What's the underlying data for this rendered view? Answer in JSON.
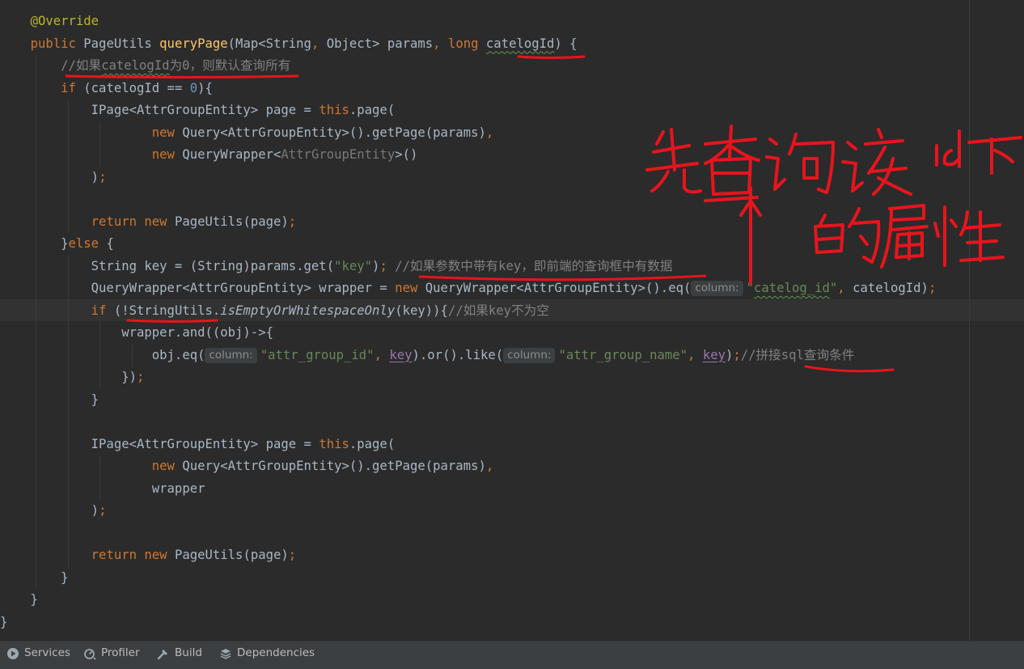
{
  "editor": {
    "lines": [
      {
        "name": "code-line-1",
        "tokens": [
          {
            "t": "    "
          },
          {
            "t": "@Override",
            "c": "ann"
          }
        ]
      },
      {
        "name": "code-line-2",
        "tokens": [
          {
            "t": "    "
          },
          {
            "t": "public ",
            "c": "kw"
          },
          {
            "t": "PageUtils "
          },
          {
            "t": "queryPage",
            "c": "fn"
          },
          {
            "t": "(Map<String"
          },
          {
            "t": ", ",
            "c": "kw"
          },
          {
            "t": "Object> params"
          },
          {
            "t": ", ",
            "c": "kw"
          },
          {
            "t": "long ",
            "c": "kw"
          },
          {
            "t": "catelogId",
            "c": "wavy"
          },
          {
            "t": ") {"
          }
        ]
      },
      {
        "name": "code-line-3",
        "tokens": [
          {
            "t": "        "
          },
          {
            "t": "//如果",
            "c": "com"
          },
          {
            "t": "catelogId",
            "c": "com wavy"
          },
          {
            "t": "为0，则默认查询所有",
            "c": "com"
          }
        ]
      },
      {
        "name": "code-line-4",
        "tokens": [
          {
            "t": "        "
          },
          {
            "t": "if ",
            "c": "kw"
          },
          {
            "t": "(catelogId == "
          },
          {
            "t": "0",
            "c": "num"
          },
          {
            "t": "){"
          }
        ]
      },
      {
        "name": "code-line-5",
        "tokens": [
          {
            "t": "            IPage<AttrGroupEntity> page = "
          },
          {
            "t": "this",
            "c": "kw"
          },
          {
            "t": ".page("
          }
        ]
      },
      {
        "name": "code-line-6",
        "tokens": [
          {
            "t": "                    "
          },
          {
            "t": "new ",
            "c": "kw"
          },
          {
            "t": "Query<AttrGroupEntity>().getPage(params)"
          },
          {
            "t": ",",
            "c": "kw"
          }
        ]
      },
      {
        "name": "code-line-7",
        "tokens": [
          {
            "t": "                    "
          },
          {
            "t": "new ",
            "c": "kw"
          },
          {
            "t": "QueryWrapper<"
          },
          {
            "t": "AttrGroupEntity",
            "c": "dim"
          },
          {
            "t": ">()"
          }
        ]
      },
      {
        "name": "code-line-8",
        "tokens": [
          {
            "t": "            )"
          },
          {
            "t": ";",
            "c": "kw"
          }
        ]
      },
      {
        "name": "code-line-9",
        "tokens": [
          {
            "t": ""
          }
        ]
      },
      {
        "name": "code-line-10",
        "tokens": [
          {
            "t": "            "
          },
          {
            "t": "return new ",
            "c": "kw"
          },
          {
            "t": "PageUtils(page)"
          },
          {
            "t": ";",
            "c": "kw"
          }
        ]
      },
      {
        "name": "code-line-11",
        "tokens": [
          {
            "t": "        }"
          },
          {
            "t": "else ",
            "c": "kw"
          },
          {
            "t": "{"
          }
        ]
      },
      {
        "name": "code-line-12",
        "tokens": [
          {
            "t": "            String key = (String)params.get("
          },
          {
            "t": "\"key\"",
            "c": "str"
          },
          {
            "t": ")"
          },
          {
            "t": "; ",
            "c": "kw"
          },
          {
            "t": "//如果参数中带有key，即前端的查询框中有数据",
            "c": "com"
          }
        ]
      },
      {
        "name": "code-line-13",
        "tokens": [
          {
            "t": "            QueryWrapper<AttrGroupEntity> wrapper = "
          },
          {
            "t": "new ",
            "c": "kw"
          },
          {
            "t": "QueryWrapper<AttrGroupEntity>().eq("
          },
          {
            "t": "column:",
            "c": "hint"
          },
          {
            "t": "\"",
            "c": "str"
          },
          {
            "t": "catelog_id",
            "c": "str wavy"
          },
          {
            "t": "\"",
            "c": "str"
          },
          {
            "t": ", ",
            "c": "kw"
          },
          {
            "t": "catelogId)"
          },
          {
            "t": ";",
            "c": "kw"
          }
        ]
      },
      {
        "name": "code-line-14",
        "tokens": [
          {
            "t": "            "
          },
          {
            "t": "if ",
            "c": "kw"
          },
          {
            "t": "(!StringUtils."
          },
          {
            "t": "isEmptyOrWhitespaceOnly",
            "c": "it"
          },
          {
            "t": "(key)){"
          },
          {
            "t": "//如果key不为空",
            "c": "com"
          }
        ]
      },
      {
        "name": "code-line-15",
        "tokens": [
          {
            "t": "                wrapper.and((obj)->{"
          }
        ]
      },
      {
        "name": "code-line-16",
        "tokens": [
          {
            "t": "                    obj.eq("
          },
          {
            "t": "column:",
            "c": "hint"
          },
          {
            "t": "\"attr_group_id\"",
            "c": "str"
          },
          {
            "t": ", ",
            "c": "kw"
          },
          {
            "t": "key",
            "c": "field ul"
          },
          {
            "t": ").or().like("
          },
          {
            "t": "column:",
            "c": "hint"
          },
          {
            "t": "\"attr_group_name\"",
            "c": "str"
          },
          {
            "t": ", ",
            "c": "kw"
          },
          {
            "t": "key",
            "c": "field ul"
          },
          {
            "t": ")"
          },
          {
            "t": ";",
            "c": "kw"
          },
          {
            "t": "//拼接sql查询条件",
            "c": "com"
          }
        ]
      },
      {
        "name": "code-line-17",
        "tokens": [
          {
            "t": "                })"
          },
          {
            "t": ";",
            "c": "kw"
          }
        ]
      },
      {
        "name": "code-line-18",
        "tokens": [
          {
            "t": "            }"
          }
        ]
      },
      {
        "name": "code-line-19",
        "tokens": [
          {
            "t": ""
          }
        ]
      },
      {
        "name": "code-line-20",
        "tokens": [
          {
            "t": "            IPage<AttrGroupEntity> page = "
          },
          {
            "t": "this",
            "c": "kw"
          },
          {
            "t": ".page("
          }
        ]
      },
      {
        "name": "code-line-21",
        "tokens": [
          {
            "t": "                    "
          },
          {
            "t": "new ",
            "c": "kw"
          },
          {
            "t": "Query<AttrGroupEntity>().getPage(params)"
          },
          {
            "t": ",",
            "c": "kw"
          }
        ]
      },
      {
        "name": "code-line-22",
        "tokens": [
          {
            "t": "                    wrapper"
          }
        ]
      },
      {
        "name": "code-line-23",
        "tokens": [
          {
            "t": "            )"
          },
          {
            "t": ";",
            "c": "kw"
          }
        ]
      },
      {
        "name": "code-line-24",
        "tokens": [
          {
            "t": ""
          }
        ]
      },
      {
        "name": "code-line-25",
        "tokens": [
          {
            "t": "            "
          },
          {
            "t": "return new ",
            "c": "kw"
          },
          {
            "t": "PageUtils(page)"
          },
          {
            "t": ";",
            "c": "kw"
          }
        ]
      },
      {
        "name": "code-line-26",
        "tokens": [
          {
            "t": "        }"
          }
        ]
      },
      {
        "name": "code-line-27",
        "tokens": [
          {
            "t": "    }"
          }
        ]
      },
      {
        "name": "code-line-28",
        "tokens": [
          {
            "t": "}"
          }
        ]
      }
    ]
  },
  "annotation": {
    "handwritten_text": "先查询该id下的属性",
    "color": "#e8141d"
  },
  "colors": {
    "background": "#2b2b2b",
    "keyword": "#cc7832",
    "string": "#6a8759",
    "comment": "#808080",
    "function": "#ffc66d",
    "annotation": "#bbb529",
    "number": "#6897bb",
    "field": "#9876aa"
  },
  "tool_windows": {
    "tabs": [
      {
        "name": "tool-tab-services",
        "label": "Services",
        "icon": "services-icon"
      },
      {
        "name": "tool-tab-profiler",
        "label": "Profiler",
        "icon": "profiler-icon"
      },
      {
        "name": "tool-tab-build",
        "label": "Build",
        "icon": "build-icon"
      },
      {
        "name": "tool-tab-dependencies",
        "label": "Dependencies",
        "icon": "dependencies-icon"
      }
    ]
  }
}
